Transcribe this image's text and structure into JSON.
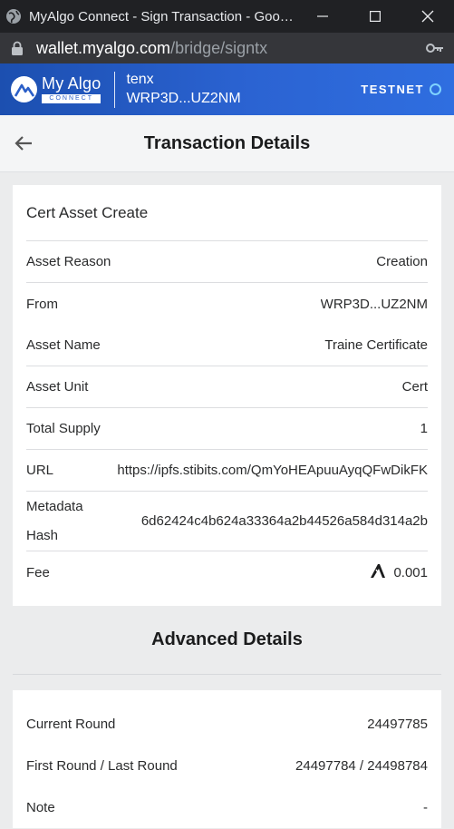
{
  "browser": {
    "window_title": "MyAlgo Connect - Sign Transaction - Googl…",
    "url_host": "wallet.myalgo.com",
    "url_path": "/bridge/signtx"
  },
  "header": {
    "logo_main": "My Algo",
    "logo_sub": "CONNECT",
    "account_name": "tenx",
    "account_address": "WRP3D...UZ2NM",
    "network": "TESTNET"
  },
  "page": {
    "title": "Transaction Details"
  },
  "transaction": {
    "type": "Cert Asset Create",
    "rows": [
      {
        "label": "Asset Reason",
        "value": "Creation"
      },
      {
        "label": "From",
        "value": "WRP3D...UZ2NM"
      },
      {
        "label": "Asset Name",
        "value": "Traine Certificate"
      },
      {
        "label": "Asset Unit",
        "value": "Cert"
      },
      {
        "label": "Total Supply",
        "value": "1"
      },
      {
        "label": "URL",
        "value": "https://ipfs.stibits.com/QmYoHEApuuAyqQFwDikFK"
      },
      {
        "label": "Metadata Hash",
        "value": "6d62424c4b624a33364a2b44526a584d314a2b"
      },
      {
        "label": "Fee",
        "value": "0.001"
      }
    ]
  },
  "advanced": {
    "title": "Advanced Details",
    "rows": [
      {
        "label": "Current Round",
        "value": "24497785"
      },
      {
        "label": "First Round / Last Round",
        "value": "24497784 / 24498784"
      },
      {
        "label": "Note",
        "value": "-"
      }
    ]
  }
}
